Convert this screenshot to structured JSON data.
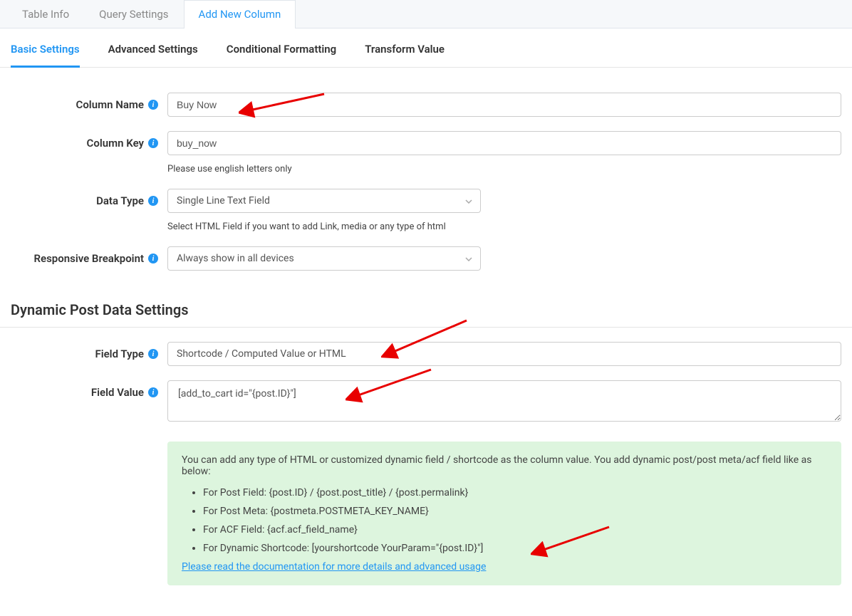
{
  "topTabs": {
    "tableInfo": "Table Info",
    "querySettings": "Query Settings",
    "addNewColumn": "Add New Column"
  },
  "subTabs": {
    "basicSettings": "Basic Settings",
    "advancedSettings": "Advanced Settings",
    "conditionalFormatting": "Conditional Formatting",
    "transformValue": "Transform Value"
  },
  "labels": {
    "columnName": "Column Name",
    "columnKey": "Column Key",
    "dataType": "Data Type",
    "responsiveBreakpoint": "Responsive Breakpoint",
    "fieldType": "Field Type",
    "fieldValue": "Field Value"
  },
  "values": {
    "columnName": "Buy Now",
    "columnKey": "buy_now",
    "dataType": "Single Line Text Field",
    "responsiveBreakpoint": "Always show in all devices",
    "fieldType": "Shortcode / Computed Value or HTML",
    "fieldValue": "[add_to_cart id=\"{post.ID}\"]"
  },
  "help": {
    "columnKey": "Please use english letters only",
    "dataType": "Select HTML Field if you want to add Link, media or any type of html"
  },
  "sectionHeading": "Dynamic Post Data Settings",
  "infoBox": {
    "intro": "You can add any type of HTML or customized dynamic field / shortcode as the column value. You add dynamic post/post meta/acf field like as below:",
    "items": [
      "For Post Field: {post.ID} / {post.post_title} / {post.permalink}",
      "For Post Meta: {postmeta.POSTMETA_KEY_NAME}",
      "For ACF Field: {acf.acf_field_name}",
      "For Dynamic Shortcode: [yourshortcode YourParam=\"{post.ID}\"]"
    ],
    "linkText": "Please read the documentation for more details and advanced usage"
  }
}
